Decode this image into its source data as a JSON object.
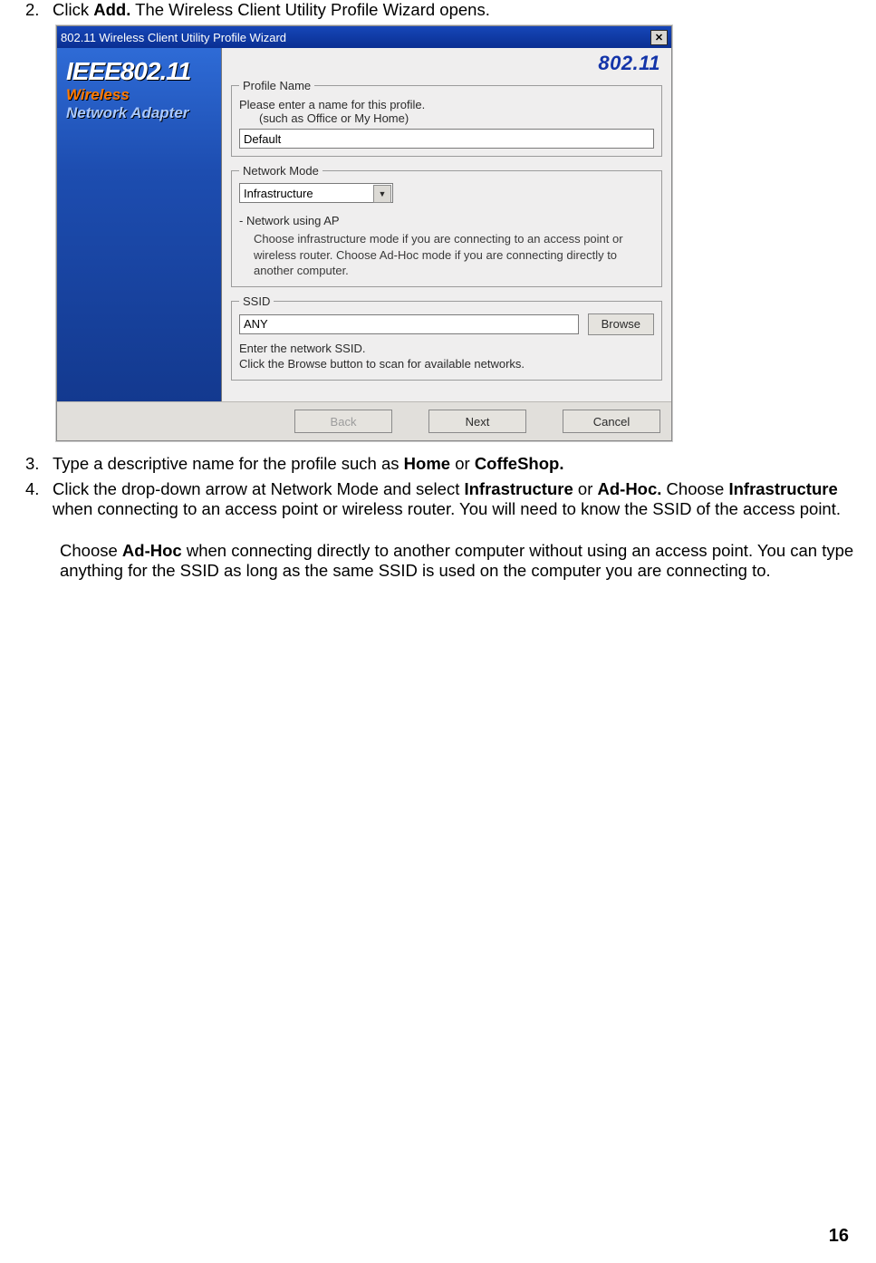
{
  "steps": {
    "s2": {
      "num": "2.",
      "pre": "Click ",
      "bold": "Add.",
      "post": " The Wireless Client Utility Profile Wizard opens."
    },
    "s3": {
      "num": "3.",
      "pre": "Type a descriptive name for the profile such as ",
      "b1": "Home",
      "mid": " or ",
      "b2": "CoffeShop."
    },
    "s4": {
      "num": "4.",
      "pre": "Click the drop-down arrow at Network Mode and select ",
      "b1": "Infrastructure",
      "mid1": " or ",
      "b2": "Ad-Hoc.",
      "mid2": " Choose ",
      "b3": "Infrastructure",
      "post": " when connecting to an access point or wireless router. You will need to know the SSID of the access point."
    },
    "adhoc": {
      "pre": "Choose ",
      "b1": "Ad-Hoc",
      "post": " when connecting directly to another computer without using an access point. You can type anything for the SSID as long as the same SSID is used on the computer you are connecting to."
    }
  },
  "dialog": {
    "title": "802.11  Wireless Client Utility Profile  Wizard",
    "close": "✕",
    "side": {
      "ieee": "IEEE802.11",
      "wireless": "Wireless",
      "netad": "Network Adapter"
    },
    "brand": "802.11",
    "profile": {
      "legend": "Profile Name",
      "line1": "Please enter a name for this profile.",
      "line2": "(such as Office or My Home)",
      "value": "Default"
    },
    "network": {
      "legend": "Network Mode",
      "value": "Infrastructure",
      "subhead": "- Network using AP",
      "desc": "Choose infrastructure mode if you are connecting to an access point or wireless router. Choose Ad-Hoc mode if you are connecting directly to another computer."
    },
    "ssid": {
      "legend": "SSID",
      "value": "ANY",
      "browse": "Browse",
      "help1": "Enter the network SSID.",
      "help2": "Click the Browse button to scan for available networks."
    },
    "buttons": {
      "back": "Back",
      "next": "Next",
      "cancel": "Cancel"
    }
  },
  "page_number": "16"
}
